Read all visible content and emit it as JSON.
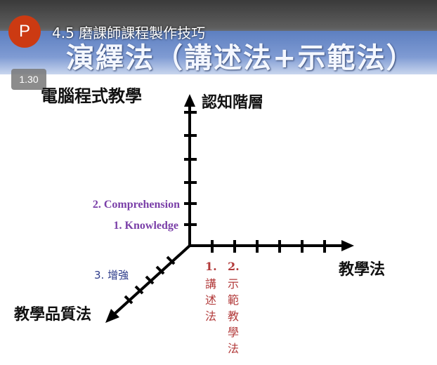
{
  "video": {
    "title": "4.5 磨課師課程製作技巧",
    "avatar_letter": "P",
    "playback_speed": "1.30"
  },
  "slide": {
    "title": "演繹法（講述法+示範法）",
    "top_left_label": "電腦程式教學",
    "vertical_axis_label": "認知階層",
    "horizontal_axis_label": "教學法",
    "diagonal_axis_label": "教學品質法",
    "level2": "2. Comprehension",
    "level1": "1. Knowledge",
    "item3": "3. 增強",
    "method1_num": "1.",
    "method1_chars": [
      "講",
      "述",
      "法"
    ],
    "method2_num": "2.",
    "method2_chars": [
      "示",
      "範",
      "教",
      "學",
      "法"
    ]
  },
  "colors": {
    "avatar": "#cc3a12",
    "purple": "#7a3fa8",
    "navy": "#2d3b8a",
    "red": "#b23a3a"
  }
}
